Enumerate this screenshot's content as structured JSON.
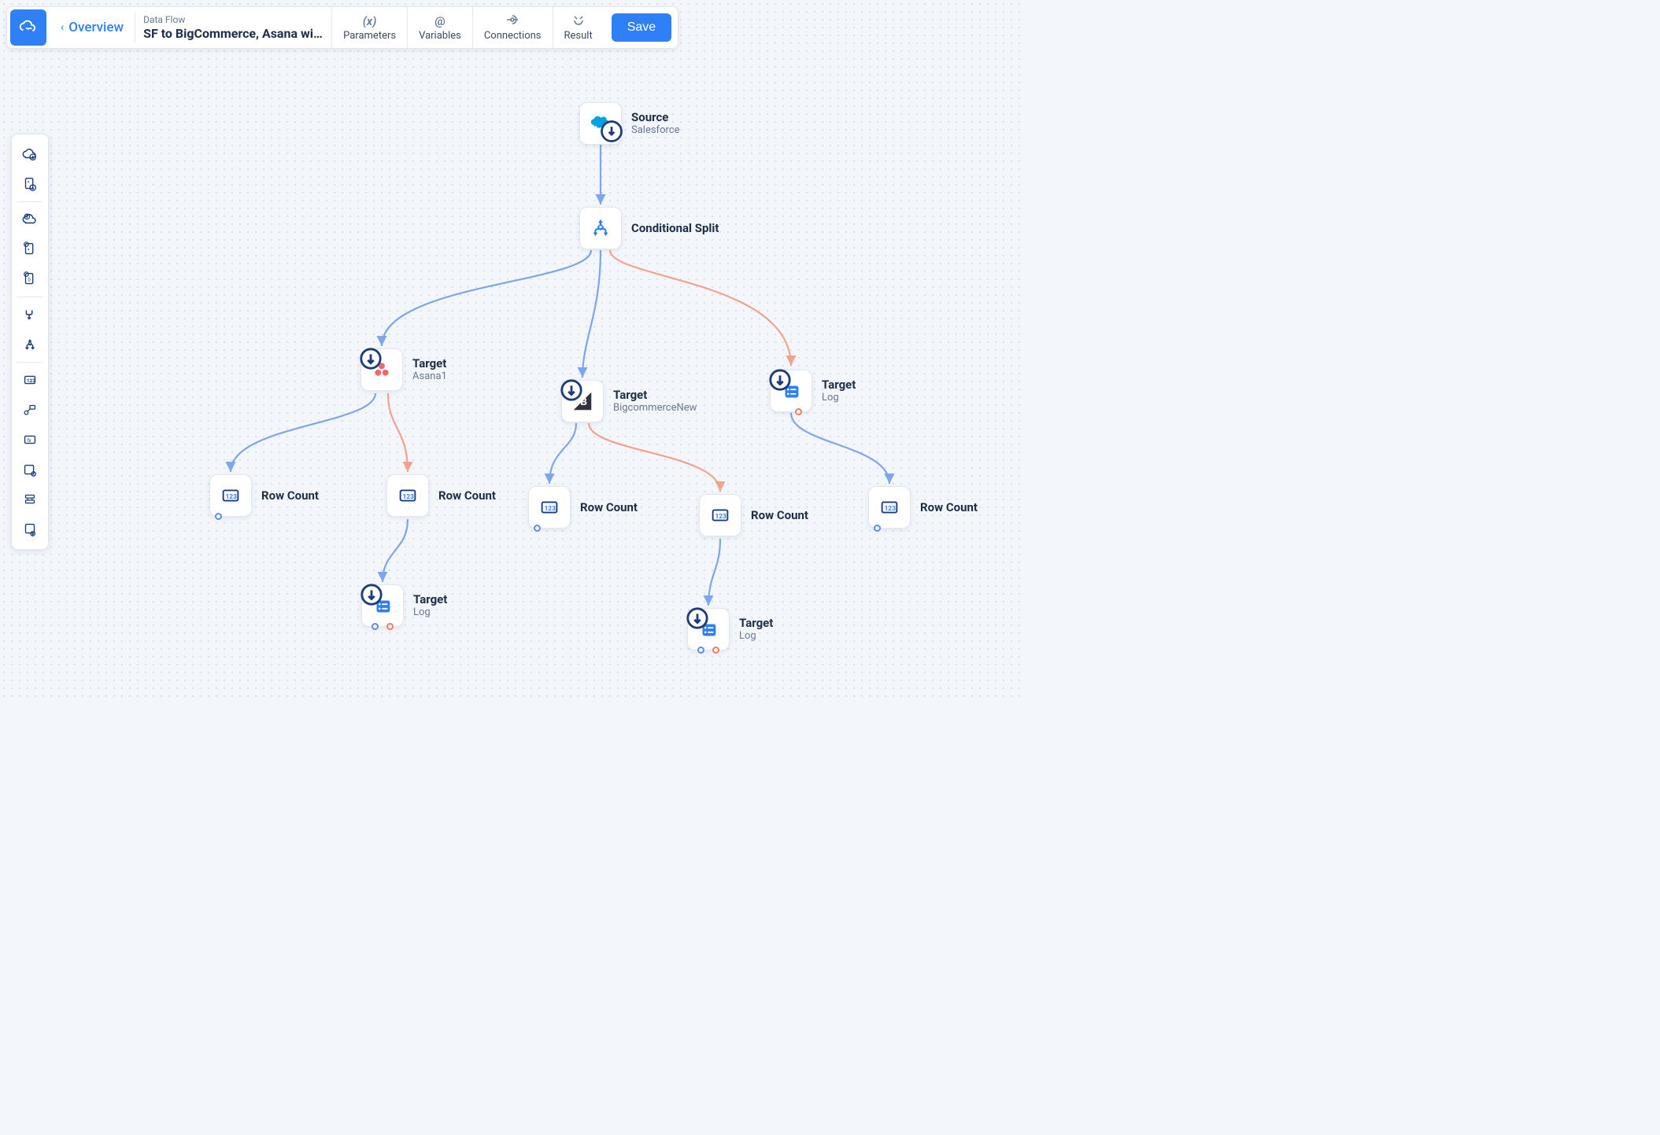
{
  "header": {
    "overview_label": "Overview",
    "type_label": "Data Flow",
    "title": "SF to BigCommerce, Asana wi…",
    "tabs": {
      "parameters": "Parameters",
      "variables": "Variables",
      "connections": "Connections",
      "result": "Result"
    },
    "save_label": "Save"
  },
  "palette": {
    "items": [
      "cloud-download",
      "file-download",
      "cloud-upload",
      "file-upload-bracket",
      "file-code-upload",
      "merge",
      "split",
      "row-count",
      "lookup",
      "expression",
      "extend",
      "union",
      "json-target"
    ]
  },
  "nodes": {
    "source": {
      "title": "Source",
      "subtitle": "Salesforce"
    },
    "cond_split": {
      "title": "Conditional Split"
    },
    "target_asana": {
      "title": "Target",
      "subtitle": "Asana1"
    },
    "target_bigc": {
      "title": "Target",
      "subtitle": "BigcommerceNew"
    },
    "target_log_right": {
      "title": "Target",
      "subtitle": "Log"
    },
    "rowcount_1": {
      "title": "Row Count"
    },
    "rowcount_2": {
      "title": "Row Count"
    },
    "rowcount_3": {
      "title": "Row Count"
    },
    "rowcount_4": {
      "title": "Row Count"
    },
    "rowcount_5": {
      "title": "Row Count"
    },
    "target_log_mid": {
      "title": "Target",
      "subtitle": "Log"
    },
    "target_log_bottom": {
      "title": "Target",
      "subtitle": "Log"
    }
  },
  "colors": {
    "primary": "#2f7ff7",
    "edge_blue": "#7da6ed",
    "edge_red": "#f4a28e",
    "text_dark": "#1f2e47",
    "text_muted": "#6b7890"
  }
}
